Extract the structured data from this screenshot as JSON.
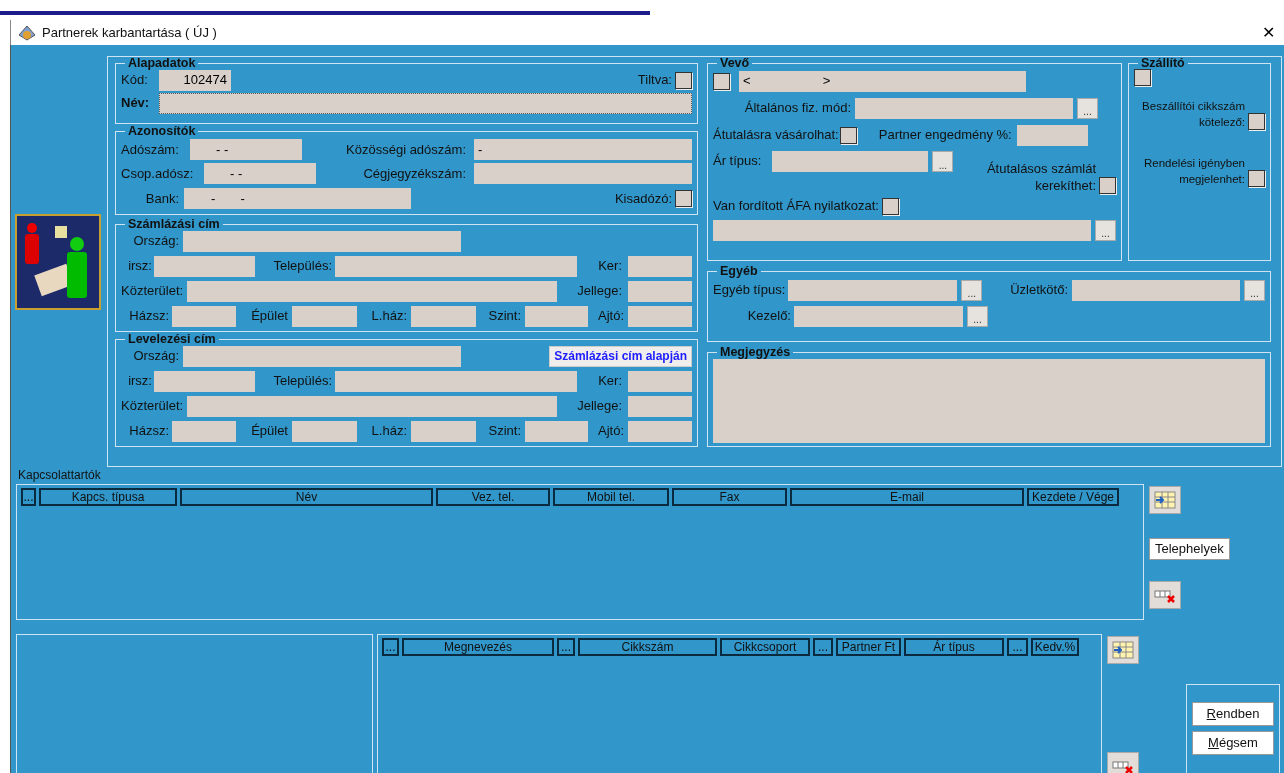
{
  "window": {
    "title": "Partnerek karbantartása ( ÚJ )",
    "close": "✕"
  },
  "alapadatok": {
    "title": "Alapadatok",
    "kod_label": "Kód:",
    "kod_value": "102474",
    "tiltva_label": "Tiltva:",
    "tiltva_checked": false,
    "nev_label": "Név:"
  },
  "azonositok": {
    "title": "Azonosítók",
    "adoszam_label": "Adószám:",
    "adoszam_value": "- -",
    "kozossegi_label": "Közösségi adószám:",
    "kozossegi_value": "-",
    "csop_label": "Csop.adósz:",
    "csop_value": "- -",
    "cegjegyzek_label": "Cégjegyzékszám:",
    "bank_label": "Bank:",
    "bank_value": "-       -",
    "kisadozo_label": "Kisadózó:",
    "kisadozo_checked": false
  },
  "szamlazasi_cim": {
    "title": "Számlázási cím",
    "orszag": "Ország:",
    "irsz": "irsz:",
    "telepules": "Település:",
    "ker": "Ker:",
    "kozterulet": "Közterület:",
    "jellege": "Jellege:",
    "hazsz": "Házsz:",
    "epulet": "Épület",
    "lhaz": "L.ház:",
    "szint": "Szint:",
    "ajto": "Ajtó:"
  },
  "levelezesi_cim": {
    "title": "Levelezési cím",
    "orszag": "Ország:",
    "copy_button": "Számlázási cím alapján",
    "irsz": "irsz:",
    "telepules": "Település:",
    "ker": "Ker:",
    "kozterulet": "Közterület:",
    "jellege": "Jellege:",
    "hazsz": "Házsz:",
    "epulet": "Épület",
    "lhaz": "L.ház:",
    "szint": "Szint:",
    "ajto": "Ajtó:"
  },
  "vevo": {
    "title": "Vevő",
    "checked": false,
    "range_value": "<                    >",
    "fiz_mod_label": "Általános fiz. mód:",
    "fiz_mod_button": "...",
    "atutalas_label": "Átutalásra vásárolhat:",
    "atutalas_checked": false,
    "engedmeny_label": "Partner engedmény %:",
    "ar_tipus_label": "Ár típus:",
    "ar_tipus_button": "...",
    "kerekit_label": "Átutalásos számlát kerekíthet:",
    "kerekit_checked": false,
    "afa_label": "Van fordított ÁFA nyilatkozat:",
    "afa_checked": false,
    "afa_button": "..."
  },
  "szallito": {
    "title": "Szállító",
    "checked": false,
    "cikkszam_label": "Beszállítói cikkszám kötelező:",
    "cikkszam_checked": false,
    "rendelesi_label": "Rendelési igényben megjelenhet:",
    "rendelesi_checked": false
  },
  "egyeb": {
    "title": "Egyéb",
    "tipus_label": "Egyéb típus:",
    "tipus_button": "...",
    "uzletkoto_label": "Üzletkötő:",
    "uzletkoto_button": "...",
    "kezelo_label": "Kezelő:",
    "kezelo_button": "..."
  },
  "megjegyzes": {
    "title": "Megjegyzés"
  },
  "kapcsolattartok": {
    "title": "Kapcsolattartók",
    "columns": [
      "...",
      "Kapcs. típusa",
      "Név",
      "Vez. tel.",
      "Mobil tel.",
      "Fax",
      "E-mail",
      "Kezdete / Vége"
    ],
    "telephelyek_button": "Telephelyek"
  },
  "tetelek": {
    "columns": [
      "...",
      "Megnevezés",
      "...",
      "Cikkszám",
      "Cikkcsoport",
      "...",
      "Partner Ft",
      "Ár típus",
      "...",
      "Kedv.%"
    ]
  },
  "buttons": [
    {
      "accel": "R",
      "rest": "endben"
    },
    {
      "accel": "M",
      "rest": "égsem"
    }
  ]
}
